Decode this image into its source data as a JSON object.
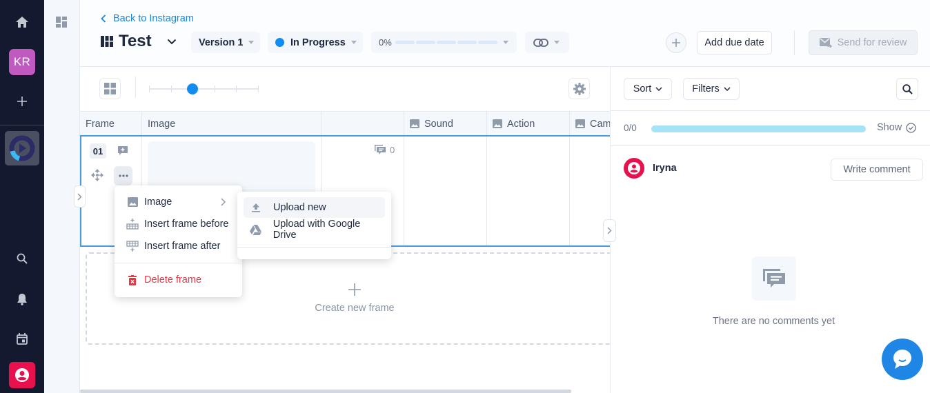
{
  "rail": {
    "avatar_initials": "KR",
    "icons": [
      "home-icon",
      "plus-icon",
      "app-logo",
      "search-icon",
      "bell-icon",
      "calendar-icon",
      "user-icon"
    ]
  },
  "header": {
    "back_label": "Back to Instagram",
    "title": "Test",
    "version": "Version 1",
    "status": "In Progress",
    "status_color": "#118cf0",
    "progress_label": "0%",
    "progress_percent": 0,
    "progress_segments": 5,
    "add_due_date": "Add due date",
    "send_for_review": "Send for review"
  },
  "toolbar": {
    "zoom_steps": 6,
    "zoom_level_index": 2
  },
  "table": {
    "columns": [
      {
        "label": "Frame",
        "icon": false
      },
      {
        "label": "Image",
        "icon": false
      },
      {
        "label": "",
        "icon": false
      },
      {
        "label": "Sound",
        "icon": true
      },
      {
        "label": "Action",
        "icon": true
      },
      {
        "label": "Cam",
        "icon": true
      }
    ],
    "rows": [
      {
        "frame_number": "01",
        "comment_count": "0"
      }
    ],
    "create_new_frame": "Create new frame"
  },
  "context_menu": {
    "items": [
      {
        "label": "Image",
        "icon": "image-icon",
        "has_submenu": true
      },
      {
        "label": "Insert frame before",
        "icon": "insert-before-icon"
      },
      {
        "label": "Insert frame after",
        "icon": "insert-after-icon"
      },
      {
        "label": "Delete frame",
        "icon": "trash-icon",
        "danger": true
      }
    ],
    "submenu": [
      {
        "label": "Upload new",
        "icon": "upload-icon"
      },
      {
        "label": "Upload with Google Drive",
        "icon": "google-drive-icon"
      }
    ]
  },
  "panel": {
    "sort_label": "Sort",
    "filters_label": "Filters",
    "progress_label": "0/0",
    "show_label": "Show",
    "user_name": "Iryna",
    "write_comment": "Write comment",
    "empty_text": "There are no comments yet"
  },
  "colors": {
    "accent": "#118cf0",
    "rail_bg": "#131a2f",
    "danger": "#e53a45",
    "avatar_kr": "#c05ac0",
    "user_red": "#e8104d"
  }
}
